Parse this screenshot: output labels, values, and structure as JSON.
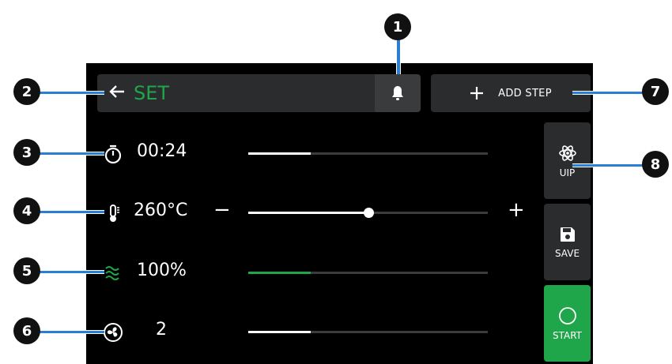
{
  "header": {
    "back_icon": "arrow-left-icon",
    "title": "SET",
    "bell_icon": "bell-icon"
  },
  "add_step": {
    "label": "ADD STEP",
    "icon": "plus-icon"
  },
  "rows": {
    "time": {
      "icon": "timer-icon",
      "value": "00:24",
      "progress": 0.26
    },
    "temperature": {
      "icon": "thermometer-icon",
      "value": "260°C",
      "minus": "−",
      "plus": "+",
      "progress": 0.5
    },
    "humidity": {
      "icon": "steam-icon",
      "value": "100%",
      "progress": 0.26
    },
    "fan": {
      "icon": "fan-icon",
      "value": "2",
      "progress": 0.26
    }
  },
  "side_buttons": {
    "uip": {
      "icon": "atom-icon",
      "label": "UIP"
    },
    "save": {
      "icon": "save-icon",
      "label": "SAVE"
    },
    "start": {
      "icon": "circle-icon",
      "label": "START"
    }
  },
  "callouts": [
    "1",
    "2",
    "3",
    "4",
    "5",
    "6",
    "7",
    "8"
  ],
  "colors": {
    "accent": "#1fa64a",
    "panel": "#2b2c2e",
    "screen": "#000000",
    "leader": "#2a7fd4"
  }
}
